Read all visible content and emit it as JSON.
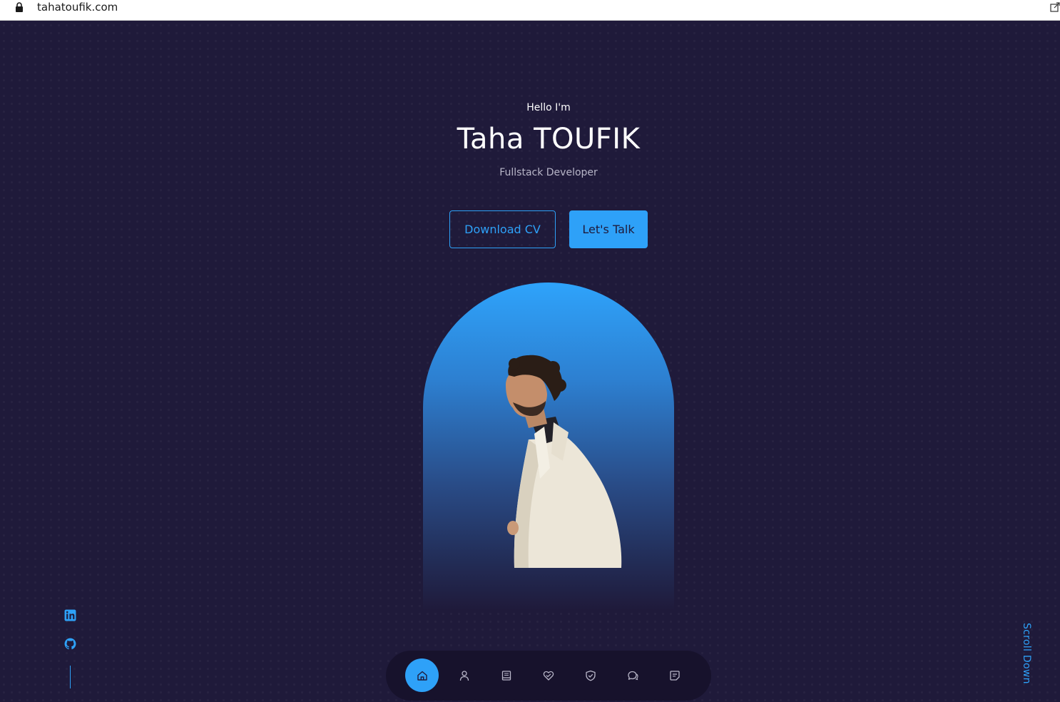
{
  "browser": {
    "url": "tahatoufik.com"
  },
  "hero": {
    "greeting": "Hello I'm",
    "name": "Taha TOUFIK",
    "role": "Fullstack Developer",
    "download_button": "Download CV",
    "talk_button": "Let's Talk"
  },
  "scroll": {
    "label": "Scroll Down"
  },
  "social": {
    "items": [
      "linkedin-icon",
      "github-icon"
    ]
  },
  "nav": {
    "items": [
      "home-icon",
      "user-icon",
      "book-icon",
      "services-icon",
      "shield-check-icon",
      "chat-icon",
      "message-icon"
    ],
    "active": "home-icon"
  },
  "colors": {
    "background": "#1f1a3a",
    "accent": "#2ea1f8",
    "nav_background": "#17122c"
  }
}
